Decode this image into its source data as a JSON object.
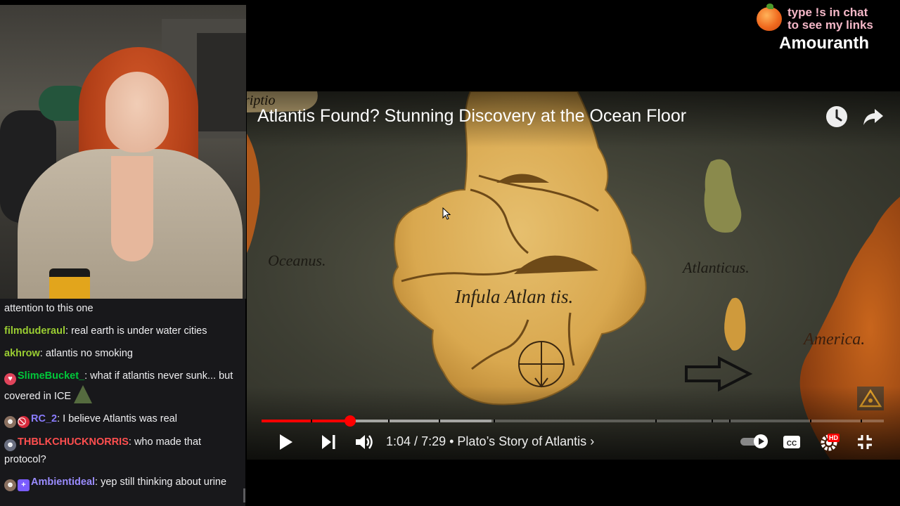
{
  "overlay": {
    "line1": "type !s in chat",
    "line2": "to see my links",
    "name": "Amouranth"
  },
  "video": {
    "title": "Atlantis Found? Stunning Discovery at the Ocean Floor",
    "time_current": "1:04",
    "time_total": "7:29",
    "chapter": "Plato’s Story of Atlantis",
    "progress_played": 0.142,
    "progress_loaded": 0.37,
    "quality_badge": "HD",
    "map_labels": {
      "oceanus": "Oceanus.",
      "insula": "Infula Atlan tis.",
      "atlanticus": "Atlanticus.",
      "america": "America.",
      "scriptio": "riptio"
    }
  },
  "chat": {
    "messages": [
      {
        "user": "",
        "text": "attention to this one",
        "color": "#efeff1"
      },
      {
        "user": "filmduderaul",
        "text": ": real earth is under water cities",
        "color": "#9acd32"
      },
      {
        "user": "akhrow",
        "text": ": atlantis no smoking",
        "color": "#9acd32"
      },
      {
        "user": "SlimeBucket_",
        "text": ": what if atlantis never sunk... but covered in ICE",
        "color": "#00c83a"
      },
      {
        "user": "RC_2",
        "text": ": I believe Atlantis was real",
        "color": "#8a7cff"
      },
      {
        "user": "THBLKCHUCKNORRIS",
        "text": ": who made that protocol?",
        "color": "#ff4f4f"
      },
      {
        "user": "Ambientideal",
        "text": ": yep still thinking about urine",
        "color": "#9a8cff"
      }
    ]
  },
  "colors": {
    "progress": "#ff0000",
    "chat_bg": "#18181b",
    "overlay_pink": "#f5b8c8"
  }
}
